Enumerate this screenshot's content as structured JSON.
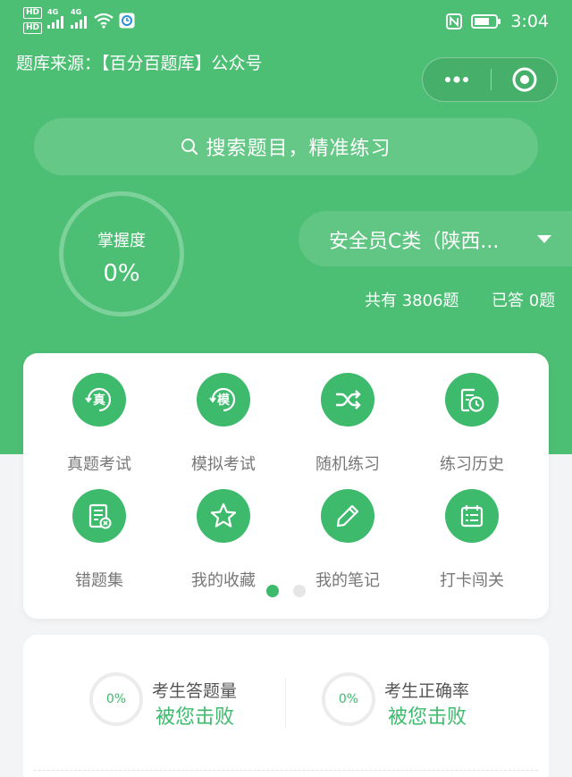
{
  "status_bar": {
    "hd_badge_1": "HD",
    "hd_badge_2": "HD",
    "net_1": "4G",
    "net_2": "4G",
    "time": "3:04"
  },
  "header": {
    "source_text": "题库来源：【百分百题库】公众号"
  },
  "search": {
    "placeholder": "搜索题目，精准练习"
  },
  "mastery": {
    "label": "掌握度",
    "value": "0%"
  },
  "exam": {
    "name": "安全员C类（陕西...",
    "total": "共有 3806题",
    "answered": "已答 0题"
  },
  "menu": {
    "items": [
      {
        "label": "真题考试",
        "icon": "real-exam-icon",
        "glyph": "真"
      },
      {
        "label": "模拟考试",
        "icon": "mock-exam-icon",
        "glyph": "模"
      },
      {
        "label": "随机练习",
        "icon": "shuffle-icon"
      },
      {
        "label": "练习历史",
        "icon": "history-icon"
      },
      {
        "label": "错题集",
        "icon": "wrong-questions-icon"
      },
      {
        "label": "我的收藏",
        "icon": "star-icon"
      },
      {
        "label": "我的笔记",
        "icon": "pencil-icon"
      },
      {
        "label": "打卡闯关",
        "icon": "calendar-checklist-icon"
      }
    ]
  },
  "stats": {
    "answered_count": {
      "percent": "0%",
      "title": "考生答题量",
      "subtitle": "被您击败"
    },
    "accuracy": {
      "percent": "0%",
      "title": "考生正确率",
      "subtitle": "被您击败"
    }
  },
  "colors": {
    "brand_green": "#4cbf74",
    "icon_green": "#3dba6c",
    "page_bg": "#f3f4f5"
  }
}
